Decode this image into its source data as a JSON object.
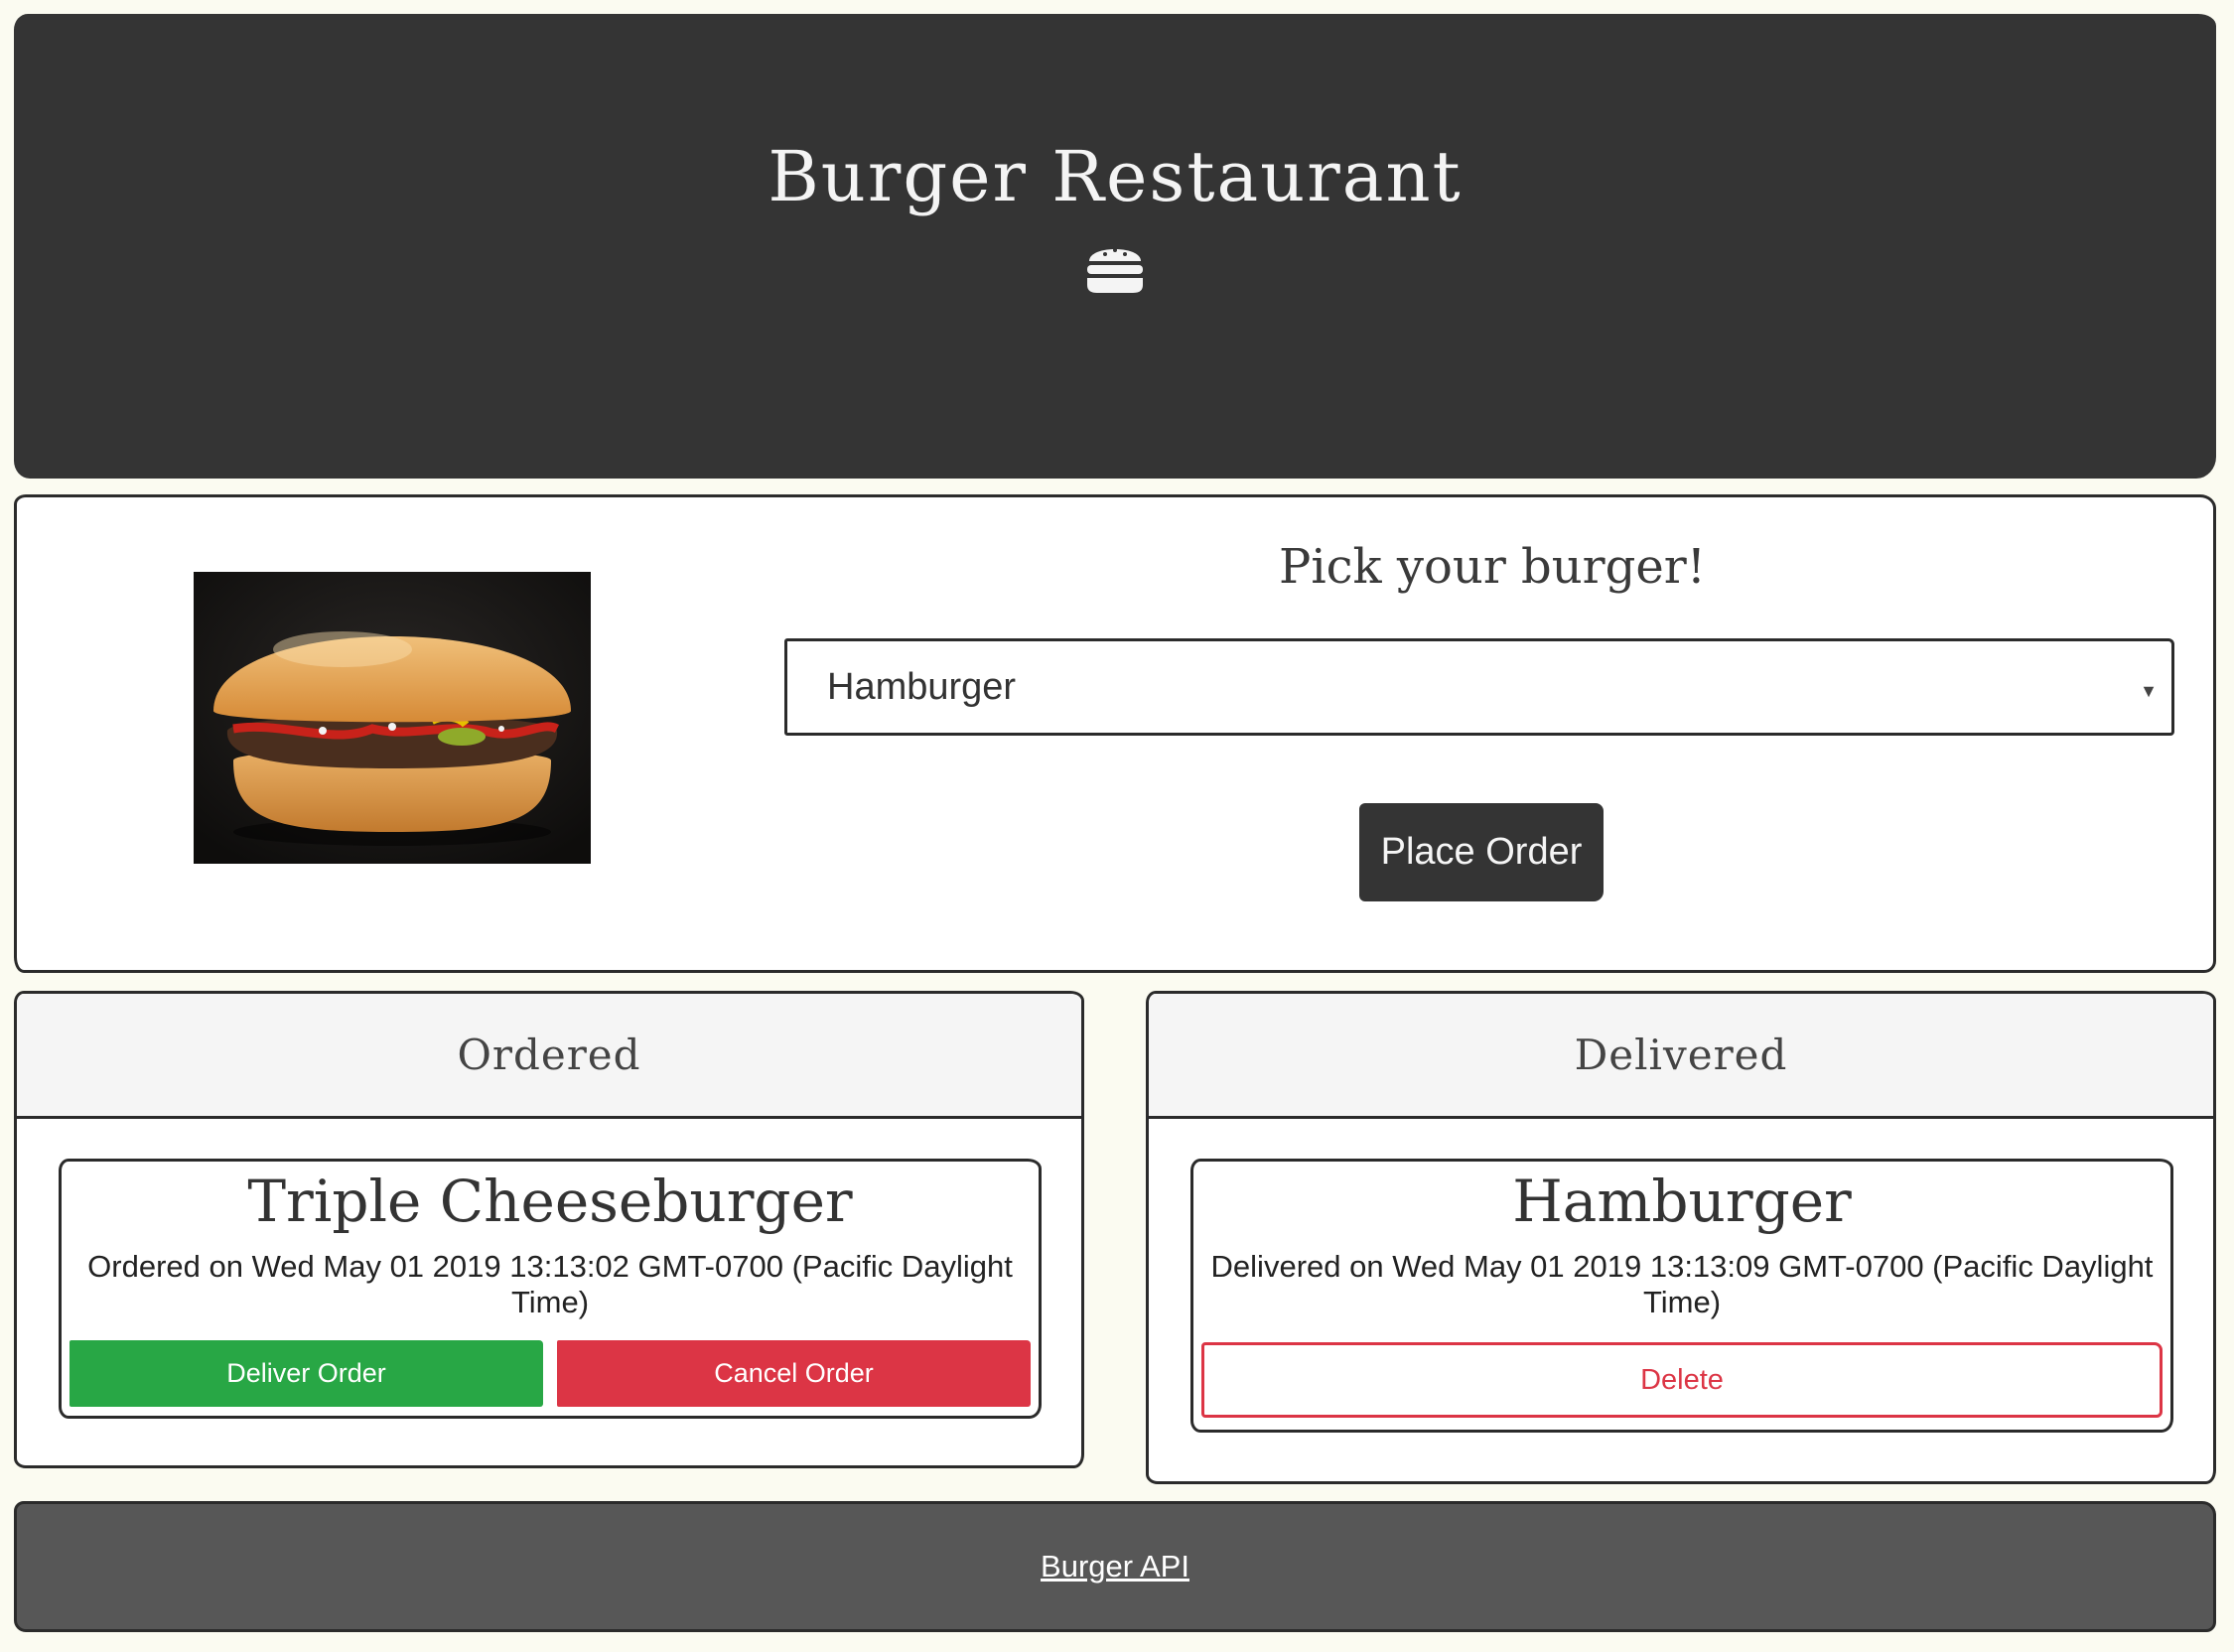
{
  "header": {
    "title": "Burger Restaurant",
    "icon": "burger-icon"
  },
  "order_form": {
    "prompt": "Pick your burger!",
    "selected_burger": "Hamburger",
    "place_order_label": "Place Order",
    "photo_alt": "hamburger photo"
  },
  "ordered": {
    "header": "Ordered",
    "items": [
      {
        "name": "Triple Cheeseburger",
        "date_text": "Ordered on Wed May 01 2019 13:13:02 GMT-0700 (Pacific Daylight Time)",
        "deliver_label": "Deliver Order",
        "cancel_label": "Cancel Order"
      }
    ]
  },
  "delivered": {
    "header": "Delivered",
    "items": [
      {
        "name": "Hamburger",
        "date_text": "Delivered on Wed May 01 2019 13:13:09 GMT-0700 (Pacific Daylight Time)",
        "delete_label": "Delete"
      }
    ]
  },
  "footer": {
    "link_label": "Burger API"
  },
  "colors": {
    "header_bg": "#343434",
    "deliver": "#28a745",
    "cancel": "#dc3545",
    "footer_bg": "#575757"
  }
}
